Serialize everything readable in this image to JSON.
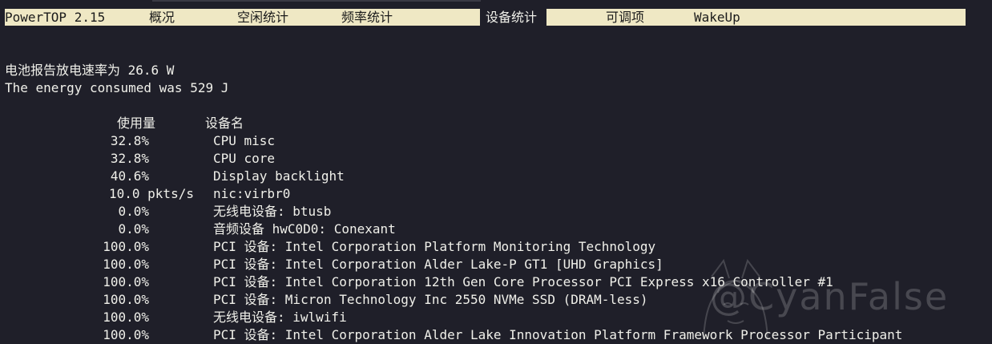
{
  "tabs": [
    {
      "label": "PowerTOP 2.15"
    },
    {
      "label": "概况"
    },
    {
      "label": "空闲统计"
    },
    {
      "label": "频率统计"
    },
    {
      "label": "设备统计"
    },
    {
      "label": "可调项"
    },
    {
      "label": "WakeUp"
    }
  ],
  "summary": {
    "battery_line": "电池报告放电速率为 26.6 W",
    "energy_line": "The energy consumed was 529 J"
  },
  "table": {
    "headers": {
      "usage": "使用量",
      "name": "设备名"
    },
    "rows": [
      {
        "usage": "32.8%",
        "name": "CPU misc"
      },
      {
        "usage": "32.8%",
        "name": "CPU core"
      },
      {
        "usage": "40.6%",
        "name": "Display backlight"
      },
      {
        "usage": "10.0 pkts/s",
        "name": "nic:virbr0"
      },
      {
        "usage": "0.0%",
        "name": "无线电设备: btusb"
      },
      {
        "usage": "0.0%",
        "name": "音频设备 hwC0D0: Conexant"
      },
      {
        "usage": "100.0%",
        "name": "PCI 设备: Intel Corporation Platform Monitoring Technology"
      },
      {
        "usage": "100.0%",
        "name": "PCI 设备: Intel Corporation Alder Lake-P GT1 [UHD Graphics]"
      },
      {
        "usage": "100.0%",
        "name": "PCI 设备: Intel Corporation 12th Gen Core Processor PCI Express x16 Controller #1"
      },
      {
        "usage": "100.0%",
        "name": "PCI 设备: Micron Technology Inc 2550 NVMe SSD (DRAM-less)"
      },
      {
        "usage": "100.0%",
        "name": "无线电设备: iwlwifi"
      },
      {
        "usage": "100.0%",
        "name": "PCI 设备: Intel Corporation Alder Lake Innovation Platform Framework Processor Participant"
      }
    ]
  },
  "watermark": {
    "text": "@CyanFalse"
  },
  "colors": {
    "background": "#1f1f29",
    "tabbar": "#efe8c4",
    "text": "#f0f0ea"
  }
}
